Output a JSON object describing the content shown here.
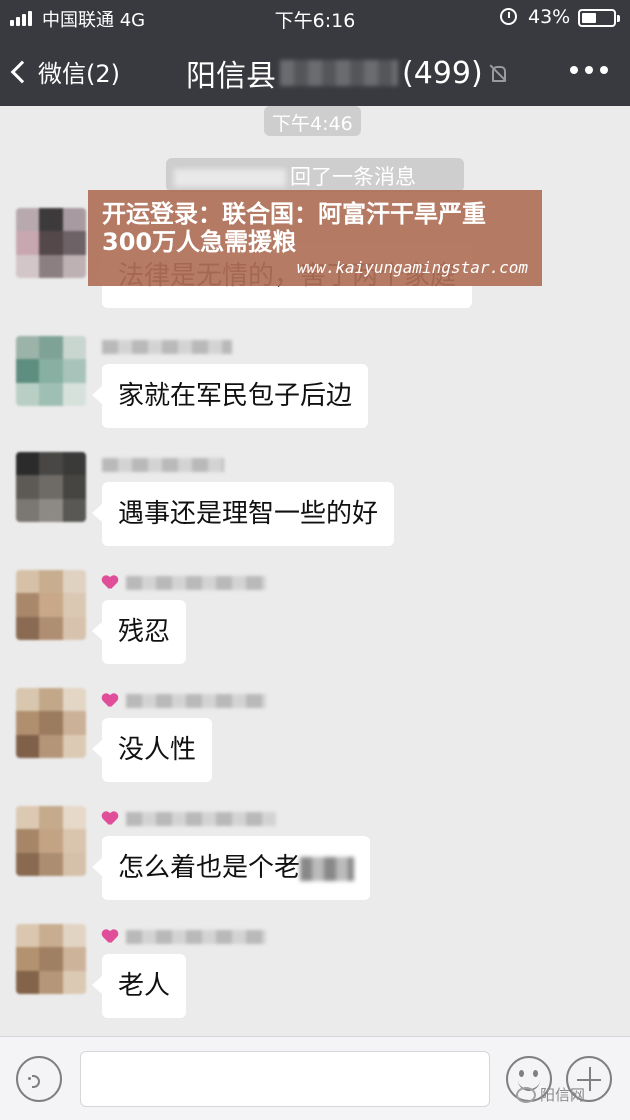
{
  "status_bar": {
    "carrier": "中国联通  4G",
    "time": "下午6:16",
    "battery": "43%"
  },
  "nav": {
    "back_label": "微信(2)",
    "title_prefix": "阳信县",
    "title_count": "(499)"
  },
  "chat": {
    "timestamp": "下午4:46",
    "system_message": "回了一条消息",
    "messages": [
      {
        "text": "法律是无情的，害了两个家庭",
        "has_heart": false
      },
      {
        "text": "家就在军民包子后边",
        "has_heart": false
      },
      {
        "text": "遇事还是理智一些的好",
        "has_heart": false
      },
      {
        "text": "残忍",
        "has_heart": true
      },
      {
        "text": "没人性",
        "has_heart": true
      },
      {
        "text": "怎么着也是个老",
        "has_heart": true
      },
      {
        "text": "老人",
        "has_heart": true
      }
    ]
  },
  "banner": {
    "headline": "开运登录：联合国：阿富汗干旱严重 300万人急需援粮",
    "url": "www.kaiyungamingstar.com"
  },
  "input_bar": {
    "watermark": "阳信网"
  },
  "colors": {
    "header": "#393a3f",
    "chat_bg": "#ebebeb",
    "bubble": "#ffffff",
    "banner": "#b07058",
    "heart": "#e04e9a"
  }
}
